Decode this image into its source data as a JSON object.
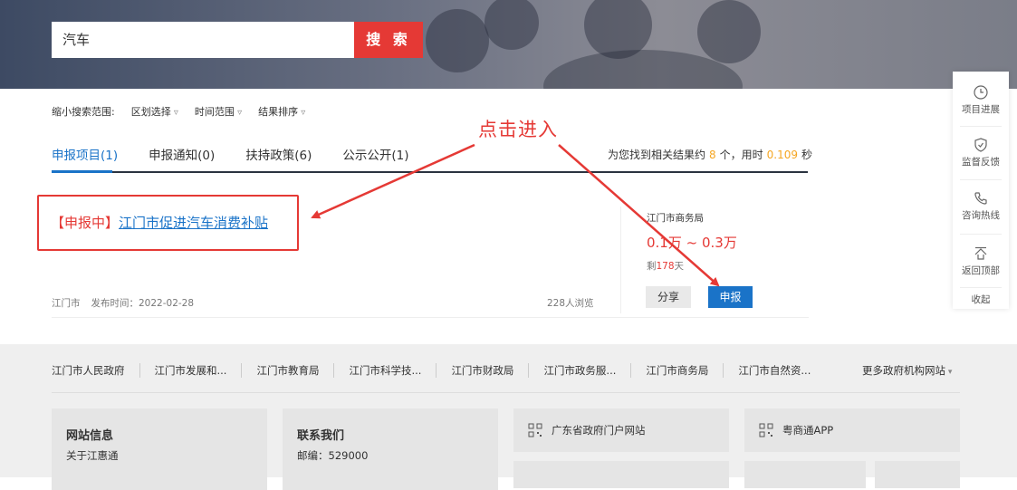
{
  "search": {
    "value": "汽车",
    "button_label": "搜 索"
  },
  "filters": {
    "label": "缩小搜索范围:",
    "region": "区划选择",
    "time": "时间范围",
    "sort": "结果排序"
  },
  "tabs": [
    {
      "label": "申报项目(1)"
    },
    {
      "label": "申报通知(0)"
    },
    {
      "label": "扶持政策(6)"
    },
    {
      "label": "公示公开(1)"
    }
  ],
  "result_info": {
    "prefix": "为您找到相关结果约",
    "count": "8",
    "mid": "个，用时",
    "time": "0.109",
    "suffix": "秒"
  },
  "annotation": {
    "text": "点击进入"
  },
  "item": {
    "status": "【申报中】",
    "title": "江门市促进汽车消费补贴",
    "region": "江门市",
    "publish_date": "发布时间：2022-02-28",
    "views": "228人浏览",
    "agency": "江门市商务局",
    "amount": "0.1万 ~ 0.3万",
    "remain_prefix": "剩",
    "remain_days": "178",
    "remain_suffix": "天",
    "share_label": "分享",
    "apply_label": "申报"
  },
  "float_bar": [
    {
      "label": "项目进展",
      "icon": "clock-icon"
    },
    {
      "label": "监督反馈",
      "icon": "shield-icon"
    },
    {
      "label": "咨询热线",
      "icon": "phone-icon"
    },
    {
      "label": "返回顶部",
      "icon": "up-arrow-icon"
    },
    {
      "label": "收起"
    }
  ],
  "footer": {
    "links": [
      "江门市人民政府",
      "江门市发展和...",
      "江门市教育局",
      "江门市科学技...",
      "江门市财政局",
      "江门市政务服...",
      "江门市商务局",
      "江门市自然资..."
    ],
    "more": "更多政府机构网站",
    "site_info": {
      "title": "网站信息",
      "about": "关于江惠通"
    },
    "contact": {
      "title": "联系我们",
      "postcode": "邮编：529000"
    },
    "portal1": "广东省政府门户网站",
    "portal2": "粤商通APP"
  },
  "colors": {
    "accent_blue": "#1a73c8",
    "accent_red": "#e53935",
    "highlight_orange": "#f5a623"
  }
}
